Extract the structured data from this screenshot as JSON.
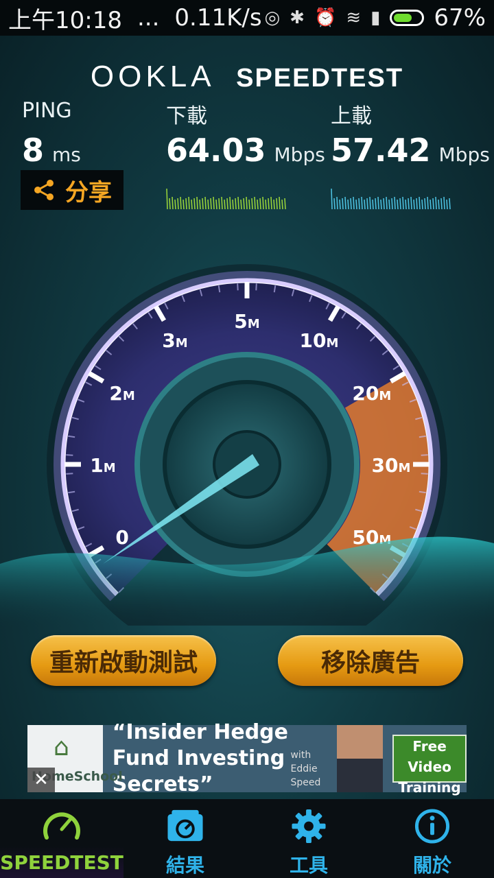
{
  "status_bar": {
    "time": "上午10:18",
    "dots": "...",
    "net_speed": "0.11K/s",
    "battery_percent": "67%",
    "battery_level": 0.67
  },
  "header": {
    "brand_ookla": "OOKLA",
    "brand_speedtest": "SPEEDTEST"
  },
  "metrics": {
    "ping": {
      "label": "PING",
      "value": "8",
      "unit": "ms"
    },
    "download": {
      "label": "下載",
      "value": "64.03",
      "unit": "Mbps"
    },
    "upload": {
      "label": "上載",
      "value": "57.42",
      "unit": "Mbps"
    }
  },
  "share": {
    "label": "分享"
  },
  "gauge": {
    "ticks": [
      {
        "num": "0",
        "unit": ""
      },
      {
        "num": "1",
        "unit": "M"
      },
      {
        "num": "2",
        "unit": "M"
      },
      {
        "num": "3",
        "unit": "M"
      },
      {
        "num": "5",
        "unit": "M"
      },
      {
        "num": "10",
        "unit": "M"
      },
      {
        "num": "20",
        "unit": "M"
      },
      {
        "num": "30",
        "unit": "M"
      },
      {
        "num": "50",
        "unit": "M"
      }
    ]
  },
  "buttons": {
    "restart": "重新啟動測試",
    "remove_ads": "移除廣告"
  },
  "ad": {
    "logo": "HomeSchool",
    "close": "✕",
    "headline": "“Insider Hedge Fund Investing Secrets”",
    "with": "with Eddie Speed",
    "cta": "Free Video Training"
  },
  "tabs": [
    {
      "label": "SPEEDTEST",
      "icon": "speedometer-icon",
      "active": true
    },
    {
      "label": "結果",
      "icon": "results-icon",
      "active": false
    },
    {
      "label": "工具",
      "icon": "gear-icon",
      "active": false
    },
    {
      "label": "關於",
      "icon": "info-icon",
      "active": false
    }
  ],
  "colors": {
    "accent_orange": "#f5a623",
    "tab_blue": "#2fb3ea",
    "tab_active_green": "#8fd23c",
    "gauge_orange": "#e07a2e"
  }
}
